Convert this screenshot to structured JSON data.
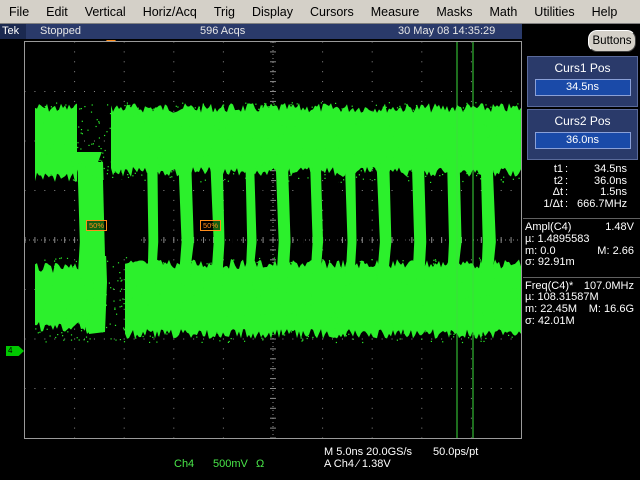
{
  "menu": [
    "File",
    "Edit",
    "Vertical",
    "Horiz/Acq",
    "Trig",
    "Display",
    "Cursors",
    "Measure",
    "Masks",
    "Math",
    "Utilities",
    "Help"
  ],
  "status": {
    "brand": "Tek",
    "state": "Stopped",
    "acqs": "596 Acqs",
    "datetime": "30 May 08 14:35:29"
  },
  "buttons_label": "Buttons",
  "cursors": {
    "curs1": {
      "title": "Curs1 Pos",
      "value": "34.5ns"
    },
    "curs2": {
      "title": "Curs2 Pos",
      "value": "36.0ns"
    },
    "readout": [
      {
        "label": "t1",
        "value": "34.5ns"
      },
      {
        "label": "t2",
        "value": "36.0ns"
      },
      {
        "label": "Δt",
        "value": "1.5ns"
      },
      {
        "label": "1/Δt",
        "value": "666.7MHz"
      }
    ]
  },
  "measurements": {
    "ampl": {
      "name": "Ampl(C4)",
      "value": "1.48V",
      "mu_label": "µ:",
      "mu": "1.4895583",
      "m_label": "m:",
      "m": "0.0",
      "M_label": "M:",
      "M": "2.66",
      "sigma_label": "σ:",
      "sigma": "92.91m"
    },
    "freq": {
      "name": "Freq(C4)*",
      "value": "107.0MHz",
      "mu_label": "µ:",
      "mu": "108.31587M",
      "m_label": "m:",
      "m": "22.45M",
      "M_label": "M:",
      "M": "16.6G",
      "sigma_label": "σ:",
      "sigma": "42.01M"
    }
  },
  "ref_markers": [
    "50%",
    "50%"
  ],
  "channel_marker": "4",
  "bottom": {
    "ch_name": "Ch4",
    "ch_scale": "500mV",
    "ch_term": "Ω",
    "timebase": "M 5.0ns 20.0GS/s",
    "resolution": "50.0ps/pt",
    "trigger": "A  Ch4  ⁄  1.38V"
  },
  "colors": {
    "trace": "#2cf02c",
    "menu_bg": "#d4d0c8",
    "status_bg": "#2a3a6a",
    "cursor": "#3cdc3c",
    "ref_marker": "#ff8c1a"
  },
  "waveform": {
    "high_level_v": 2.66,
    "low_level_v": 0.0
  }
}
